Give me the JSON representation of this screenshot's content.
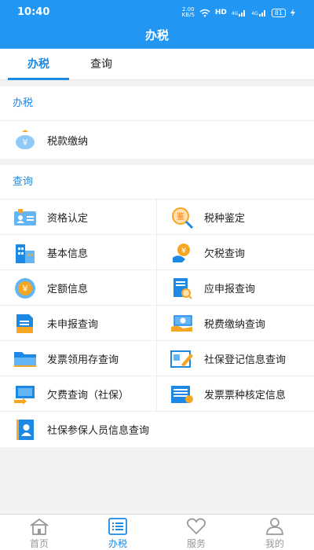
{
  "status_bar": {
    "time": "10:40",
    "net_speed_value": "2.00",
    "net_speed_unit": "KB/S",
    "hd": "HD",
    "signal_1": "4G",
    "signal_2": "4G",
    "battery": "81"
  },
  "header": {
    "title": "办税"
  },
  "tabs": [
    {
      "label": "办税",
      "active": true
    },
    {
      "label": "查询",
      "active": false
    }
  ],
  "section_tax": {
    "title": "办税",
    "items": [
      {
        "label": "税款缴纳",
        "icon": "tax-payment-icon"
      }
    ]
  },
  "section_query": {
    "title": "查询",
    "items": [
      {
        "label": "资格认定",
        "icon": "qualification-icon"
      },
      {
        "label": "税种鉴定",
        "icon": "tax-type-appraisal-icon"
      },
      {
        "label": "基本信息",
        "icon": "building-icon"
      },
      {
        "label": "欠税查询",
        "icon": "tax-arrears-icon"
      },
      {
        "label": "定额信息",
        "icon": "quota-coin-icon"
      },
      {
        "label": "应申报查询",
        "icon": "declaration-icon"
      },
      {
        "label": "未申报查询",
        "icon": "undeclared-icon"
      },
      {
        "label": "税费缴纳查询",
        "icon": "fee-payment-icon"
      },
      {
        "label": "发票领用存查询",
        "icon": "folder-icon"
      },
      {
        "label": "社保登记信息查询",
        "icon": "social-security-registration-icon"
      },
      {
        "label": "欠费查询（社保）",
        "icon": "arrears-social-security-icon"
      },
      {
        "label": "发票票种核定信息",
        "icon": "invoice-type-icon"
      },
      {
        "label": "社保参保人员信息查询",
        "icon": "insured-person-icon"
      }
    ]
  },
  "bottom_nav": [
    {
      "label": "首页",
      "icon": "home-icon",
      "active": false
    },
    {
      "label": "办税",
      "icon": "list-icon",
      "active": true
    },
    {
      "label": "服务",
      "icon": "heart-icon",
      "active": false
    },
    {
      "label": "我的",
      "icon": "person-icon",
      "active": false
    }
  ],
  "colors": {
    "brand": "#2196f3",
    "accent": "#1e88e5",
    "icon_orange": "#f5a623"
  }
}
